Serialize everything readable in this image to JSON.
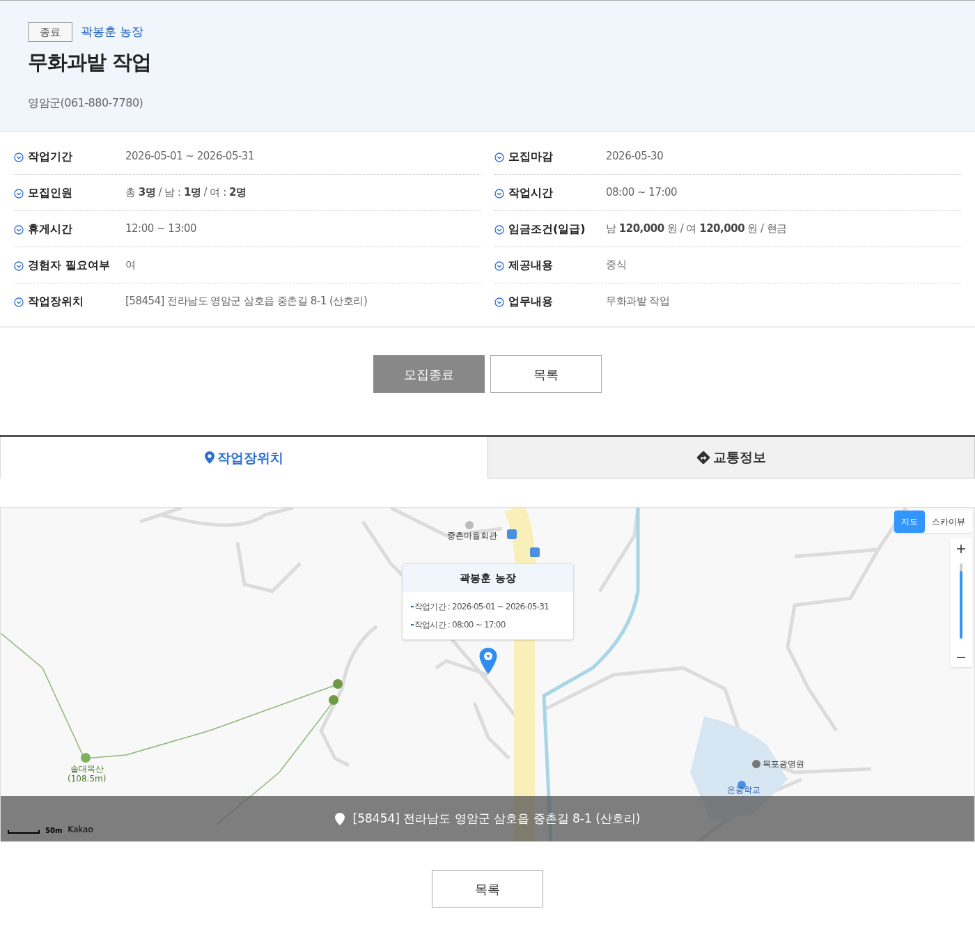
{
  "status_badge": "종료",
  "farm_name": "곽봉훈 농장",
  "title": "무화과밭 작업",
  "contact": "영암군(061-880-7780)",
  "details": [
    {
      "label": "작업기간",
      "value": "2026-05-01 ~ 2026-05-31"
    },
    {
      "label": "모집마감",
      "value": "2026-05-30"
    },
    {
      "label": "모집인원",
      "value": "총 **3명** / 남 : **1명** / 여 : **2명**"
    },
    {
      "label": "작업시간",
      "value": "08:00 ~ 17:00"
    },
    {
      "label": "휴게시간",
      "value": "12:00 ~ 13:00"
    },
    {
      "label": "임금조건(일급)",
      "value": "남 **120,000** 원 / 여 **120,000** 원 / 현금"
    },
    {
      "label": "경험자 필요여부",
      "value": "여"
    },
    {
      "label": "제공내용",
      "value": "중식"
    },
    {
      "label": "작업장위치",
      "value": "[58454] 전라남도 영암군 삼호읍 중촌길 8-1 (산호리)"
    },
    {
      "label": "업무내용",
      "value": "무화과밭 작업"
    }
  ],
  "actions": [
    {
      "label": "모집종료",
      "kind": "primary"
    },
    {
      "label": "목록",
      "kind": "outline"
    }
  ],
  "tabs": [
    {
      "label": "작업장위치",
      "selected": true
    },
    {
      "label": "교통정보",
      "selected": false
    }
  ],
  "map": {
    "map_types": [
      {
        "label": "지도",
        "selected": true
      },
      {
        "label": "스카이뷰",
        "selected": false
      }
    ],
    "zoom": {
      "level": 0.9
    },
    "popup": {
      "title": "곽봉훈 농장",
      "lines": [
        "작업기간 : 2026-05-01 ~ 2026-05-31",
        "작업시간 : 08:00 ~ 17:00"
      ]
    },
    "labels": [
      {
        "text": "중촌마을회관",
        "kind": "poi"
      },
      {
        "text": "목포광명원",
        "kind": "poi"
      },
      {
        "text": "은광학교",
        "kind": "school"
      },
      {
        "text": "솔대목산\n(108.5m)",
        "kind": "mountain"
      }
    ],
    "scale": "50m",
    "attribution": "Kakao",
    "address": "[58454] 전라남도 영암군 삼호읍 중촌길 8-1 (산호리)"
  },
  "bottom_button": "목록"
}
